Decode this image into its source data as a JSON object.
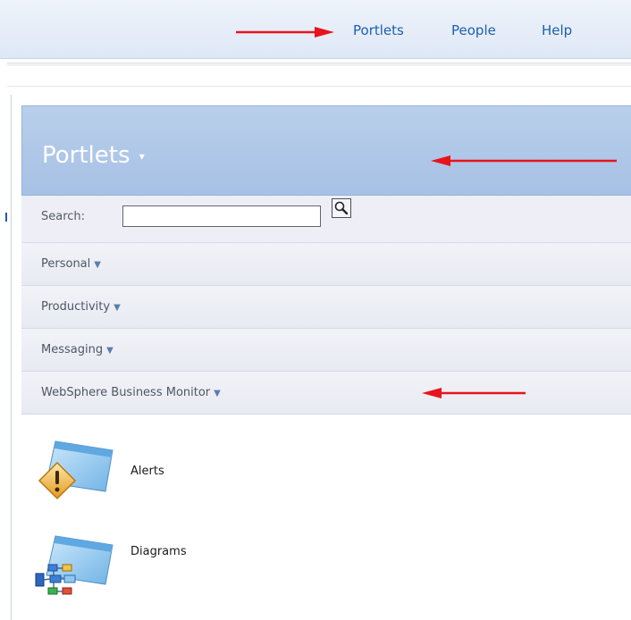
{
  "topnav": {
    "items": [
      "Portlets",
      "People",
      "Help"
    ]
  },
  "panel": {
    "title": "Portlets"
  },
  "search": {
    "label": "Search:",
    "value": ""
  },
  "categories": [
    "Personal",
    "Productivity",
    "Messaging",
    "WebSphere Business Monitor"
  ],
  "portlets": [
    {
      "label": "Alerts",
      "icon": "alerts-warning-icon"
    },
    {
      "label": "Diagrams",
      "icon": "diagrams-flowchart-icon"
    }
  ],
  "annotation_color": "#e8141b"
}
